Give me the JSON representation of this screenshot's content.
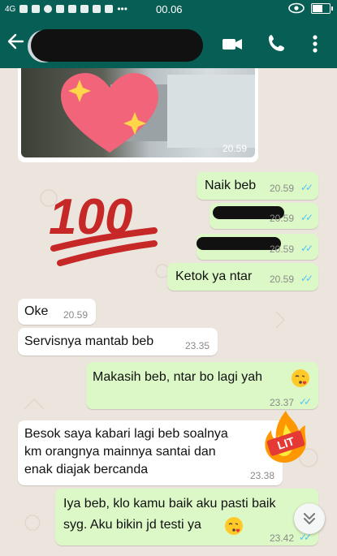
{
  "status_bar": {
    "network": "4G",
    "time": "00.06"
  },
  "header": {
    "contact_name": "",
    "back_icon": "arrow-left-icon",
    "video_icon": "video-camera-icon",
    "call_icon": "phone-icon",
    "menu_icon": "more-vertical-icon"
  },
  "colors": {
    "header": "#075e54",
    "outgoing_bubble": "#dcf8c6",
    "incoming_bubble": "#ffffff",
    "read_ticks": "#4fc3f7",
    "chat_bg": "#ece5dd"
  },
  "stickers": {
    "hundred": "100"
  },
  "messages": [
    {
      "direction": "in",
      "type": "image",
      "time": "20.59"
    },
    {
      "direction": "out",
      "text": "Naik beb",
      "time": "20.59",
      "read": true
    },
    {
      "direction": "out",
      "text": "",
      "time": "20.59",
      "read": true,
      "redacted": true
    },
    {
      "direction": "out",
      "text": "",
      "time": "20.59",
      "read": true,
      "redacted": true
    },
    {
      "direction": "out",
      "text": "Ketok ya ntar",
      "time": "20.59",
      "read": true
    },
    {
      "direction": "in",
      "text": "Oke",
      "time": "20.59"
    },
    {
      "direction": "in",
      "text": "Servisnya mantab beb",
      "time": "23.35"
    },
    {
      "direction": "out",
      "text": "Makasih beb, ntar bo lagi yah",
      "time": "23.37",
      "read": true
    },
    {
      "direction": "in",
      "lines": [
        "Besok saya kabari lagi beb soalnya",
        "km orangnya mainnya santai  dan",
        "enak diajak bercanda"
      ],
      "time": "23.38"
    },
    {
      "direction": "out",
      "lines": [
        "Iya beb, klo kamu baik aku pasti baik",
        "syg. Aku bikin jd testi ya"
      ],
      "time": "23.42",
      "read": true
    }
  ],
  "scroll_down_icon": "double-chevron-down-icon"
}
